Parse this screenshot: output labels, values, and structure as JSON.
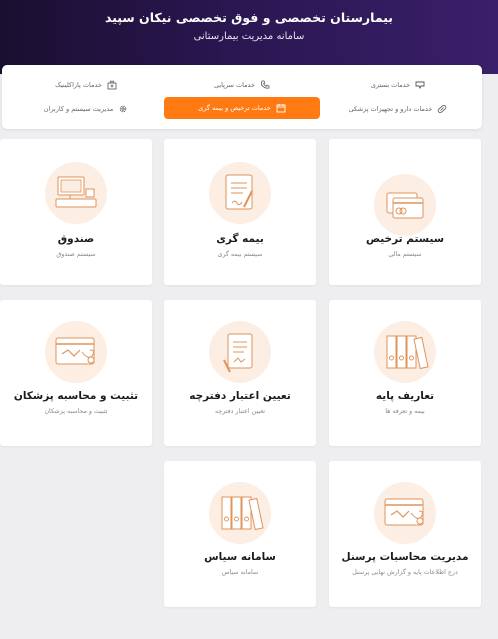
{
  "header": {
    "title": "بیمارستان تخصصی و فوق تخصصی نیکان سپید",
    "subtitle": "سامانه مدیریت بیمارستانی"
  },
  "tabs": [
    {
      "label": "خدمات بستری",
      "icon": "bed-icon"
    },
    {
      "label": "خدمات سرپایی",
      "icon": "phone-icon"
    },
    {
      "label": "خدمات پاراکلینیک",
      "icon": "medical-bag-icon"
    },
    {
      "label": "خدمات دارو و تجهیزات پزشکی",
      "icon": "pill-icon"
    },
    {
      "label": "خدمات ترخیص و بیمه گری",
      "icon": "calendar-icon",
      "active": true
    },
    {
      "label": "مدیریت سیستم و کاربران",
      "icon": "gear-icon"
    }
  ],
  "cards": [
    {
      "title": "سیستم ترخیص",
      "subtitle": "سیستم مالی",
      "icon": "credit-card-icon"
    },
    {
      "title": "بیمه گری",
      "subtitle": "سیستم بیمه گری",
      "icon": "insurance-form-icon"
    },
    {
      "title": "صندوق",
      "subtitle": "سیستم صندوق",
      "icon": "cash-register-icon"
    },
    {
      "title": "تعاریف پایه",
      "subtitle": "بیمه و تعرفه ها",
      "icon": "binders-icon"
    },
    {
      "title": "تعیین اعتبار دفترچه",
      "subtitle": "تعیین اعتبار دفترچه",
      "icon": "booklet-icon"
    },
    {
      "title": "تثبیت و محاسبه پزشکان",
      "subtitle": "تثبیت و محاسبه پزشکان",
      "icon": "stethoscope-card-icon"
    },
    {
      "title": "مدیریت محاسبات پرسنل",
      "subtitle": "درج اطلاعات پایه و گزارش نهایی پرسنل",
      "icon": "stethoscope-card-icon"
    },
    {
      "title": "سامانه سیاس",
      "subtitle": "سامانه سیاس",
      "icon": "binders-icon"
    }
  ],
  "colors": {
    "header": "#2a1650",
    "accent": "#ff7a12",
    "icon_circle": "#fdeee3",
    "background": "#eeeef1"
  }
}
